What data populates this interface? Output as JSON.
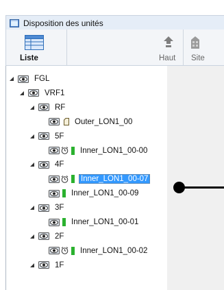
{
  "window": {
    "title": "Disposition des unités"
  },
  "toolbar": {
    "liste": "Liste",
    "haut": "Haut",
    "site": "Site"
  },
  "tree": [
    {
      "label": "FGL",
      "level": 0,
      "expander": "expanded",
      "icons": [
        "eye"
      ]
    },
    {
      "label": "VRF1",
      "level": 1,
      "expander": "expanded",
      "icons": [
        "eye"
      ]
    },
    {
      "label": "RF",
      "level": 2,
      "expander": "expanded",
      "icons": [
        "eye"
      ]
    },
    {
      "label": "Outer_LON1_00",
      "level": 3,
      "expander": "none",
      "icons": [
        "eye",
        "outer-unit"
      ]
    },
    {
      "label": "5F",
      "level": 2,
      "expander": "expanded",
      "icons": [
        "eye"
      ]
    },
    {
      "label": "Inner_LON1_00-00",
      "level": 3,
      "expander": "none",
      "icons": [
        "eye",
        "alarm",
        "green-status"
      ]
    },
    {
      "label": "4F",
      "level": 2,
      "expander": "expanded",
      "icons": [
        "eye"
      ]
    },
    {
      "label": "Inner_LON1_00-07",
      "level": 3,
      "expander": "none",
      "icons": [
        "eye",
        "alarm",
        "green-status"
      ],
      "selected": true
    },
    {
      "label": "Inner_LON1_00-09",
      "level": 3,
      "expander": "none",
      "icons": [
        "eye",
        "green-status"
      ]
    },
    {
      "label": "3F",
      "level": 2,
      "expander": "expanded",
      "icons": [
        "eye"
      ]
    },
    {
      "label": "Inner_LON1_00-01",
      "level": 3,
      "expander": "none",
      "icons": [
        "eye",
        "green-status"
      ]
    },
    {
      "label": "2F",
      "level": 2,
      "expander": "expanded",
      "icons": [
        "eye"
      ]
    },
    {
      "label": "Inner_LON1_00-02",
      "level": 3,
      "expander": "none",
      "icons": [
        "eye",
        "alarm",
        "green-status"
      ]
    },
    {
      "label": "1F",
      "level": 2,
      "expander": "expanded",
      "icons": [
        "eye"
      ]
    }
  ],
  "colors": {
    "selection": "#3399ff",
    "status_green": "#2bb12f",
    "titlebar": "#e5edf7"
  }
}
